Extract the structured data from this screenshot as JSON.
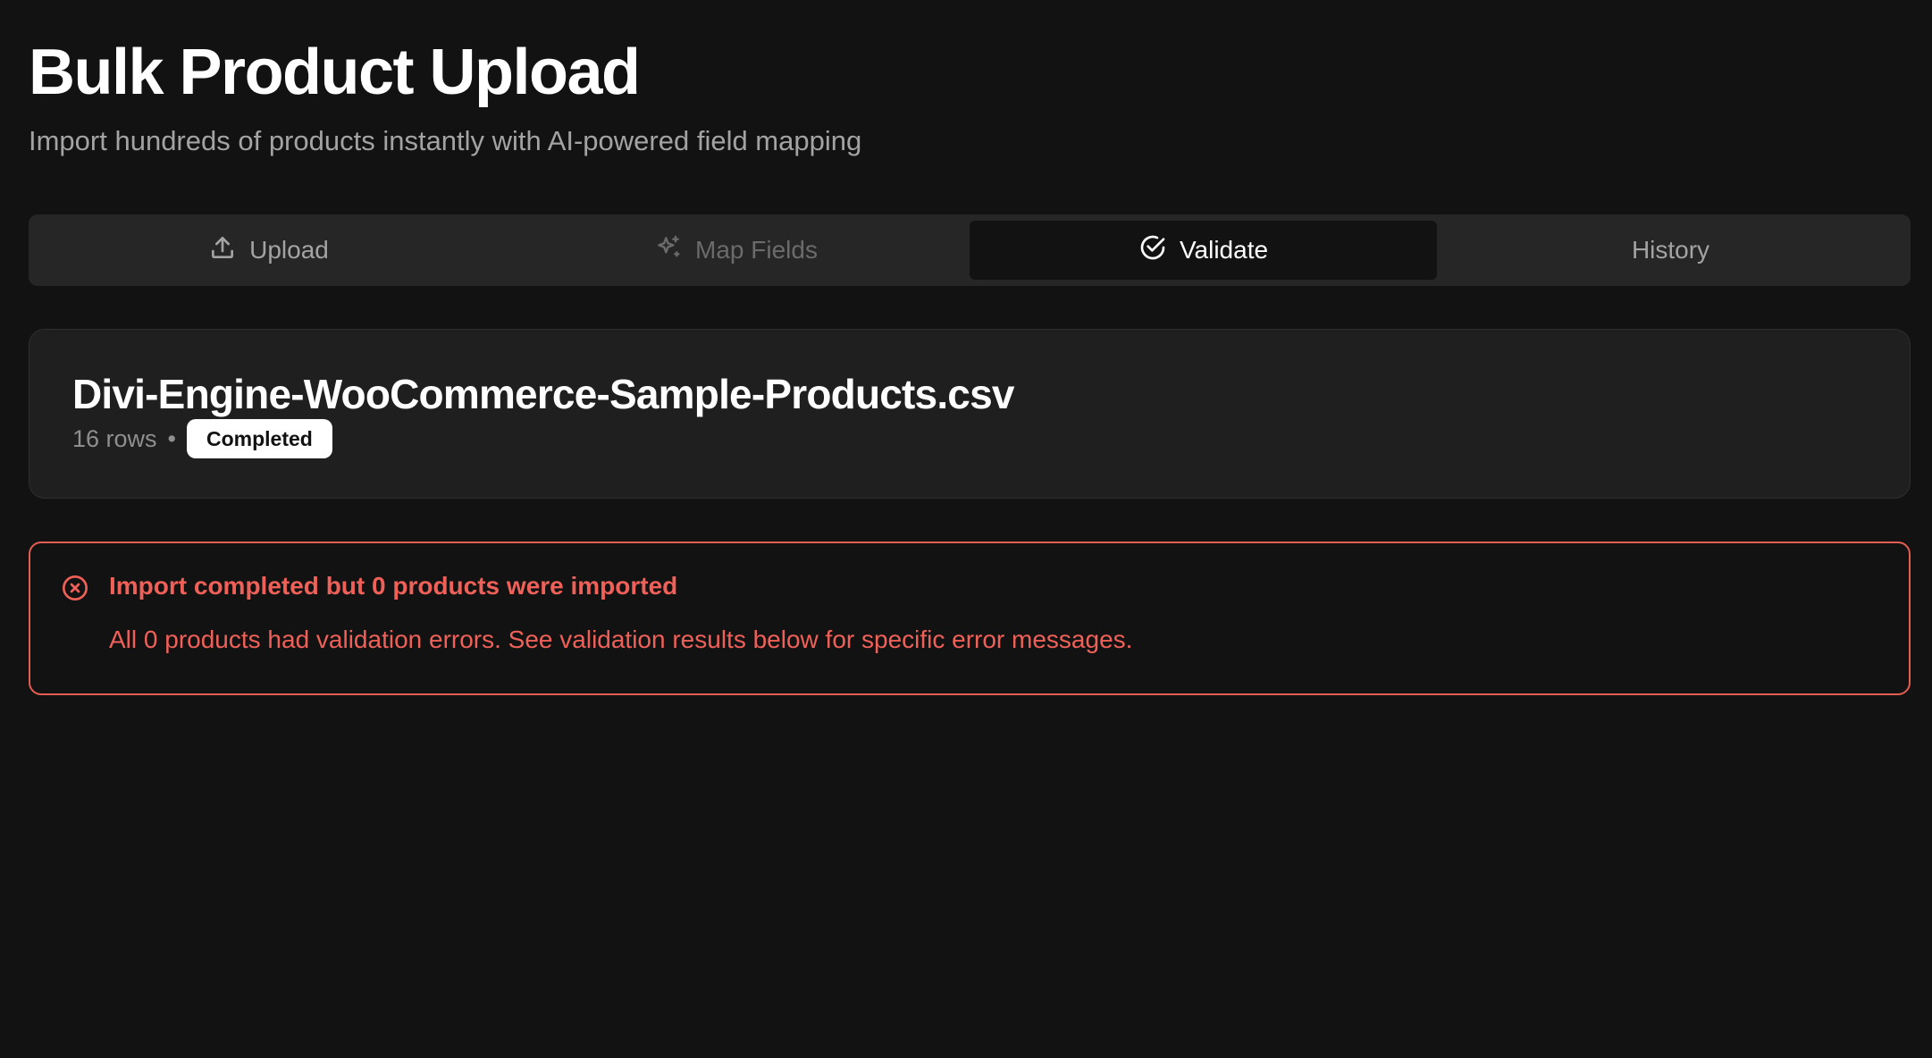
{
  "header": {
    "title": "Bulk Product Upload",
    "subtitle": "Import hundreds of products instantly with AI-powered field mapping"
  },
  "tabs": [
    {
      "label": "Upload",
      "icon": "upload-icon",
      "state": "default"
    },
    {
      "label": "Map Fields",
      "icon": "sparkles-icon",
      "state": "disabled"
    },
    {
      "label": "Validate",
      "icon": "check-circle-icon",
      "state": "active"
    },
    {
      "label": "History",
      "icon": "",
      "state": "default"
    }
  ],
  "file": {
    "name": "Divi-Engine-WooCommerce-Sample-Products.csv",
    "rows": "16 rows",
    "separator": "•",
    "status": "Completed"
  },
  "alert": {
    "icon": "x-circle-icon",
    "title": "Import completed but 0 products were imported",
    "message": "All 0 products had validation errors. See validation results below for specific error messages.",
    "color": "#ef6158"
  },
  "colors": {
    "background": "#121212",
    "tab_bar": "#262626",
    "card": "#1f1f1f",
    "error": "#ef6158"
  }
}
